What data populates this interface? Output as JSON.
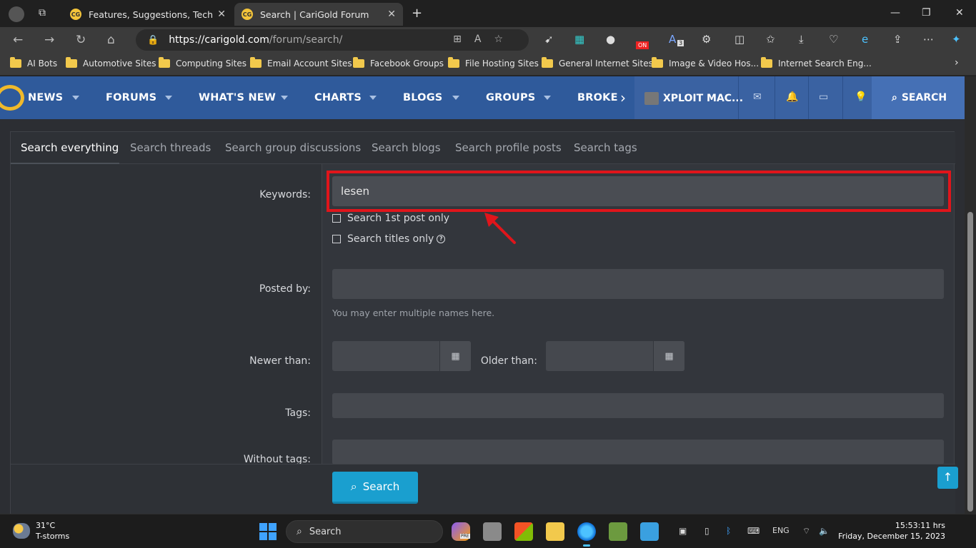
{
  "browser": {
    "tabs": [
      {
        "title": "Features, Suggestions, Technical S",
        "active": false
      },
      {
        "title": "Search | CariGold Forum",
        "active": true
      }
    ],
    "url_host": "https://carigold.com",
    "url_path": "/forum/search/",
    "bookmarks": [
      "AI Bots",
      "Automotive Sites",
      "Computing Sites",
      "Email Account Sites",
      "Facebook Groups",
      "File Hosting Sites",
      "General Internet Sites",
      "Image & Video Hos...",
      "Internet Search Eng..."
    ],
    "extension_badge": "3",
    "extension_on_label": "ON"
  },
  "site_nav": {
    "items": [
      "NEWS",
      "FORUMS",
      "WHAT'S NEW",
      "CHARTS",
      "BLOGS",
      "GROUPS",
      "BROKE"
    ],
    "user": "XPLOIT MAC...",
    "search_label": "SEARCH"
  },
  "search_tabs": [
    "Search everything",
    "Search threads",
    "Search group discussions",
    "Search blogs",
    "Search profile posts",
    "Search tags"
  ],
  "form": {
    "keywords_label": "Keywords:",
    "keywords_value": "lesen",
    "first_post_only": "Search 1st post only",
    "titles_only": "Search titles only",
    "posted_by_label": "Posted by:",
    "posted_by_hint": "You may enter multiple names here.",
    "newer_than_label": "Newer than:",
    "older_than_label": "Older than:",
    "tags_label": "Tags:",
    "without_tags_label": "Without tags:",
    "submit_label": "Search"
  },
  "taskbar": {
    "temperature": "31°C",
    "weather": "T-storms",
    "search_placeholder": "Search",
    "language": "ENG",
    "time": "15:53:11 hrs",
    "date": "Friday, December 15, 2023",
    "copilot_badge": "PRE"
  },
  "colors": {
    "nav_bg": "#2f5a9b",
    "highlight": "#e0151b",
    "accent_button": "#1a9fcf"
  }
}
